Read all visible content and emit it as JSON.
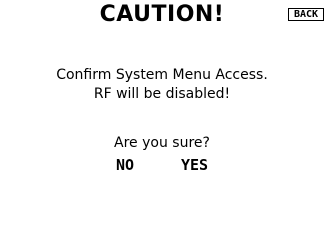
{
  "dialog": {
    "title": "CAUTION!",
    "back_label": "BACK",
    "message_line1": "Confirm System Menu Access.",
    "message_line2": "RF will be disabled!",
    "question": "Are you sure?",
    "no_label": "NO",
    "yes_label": "YES"
  }
}
